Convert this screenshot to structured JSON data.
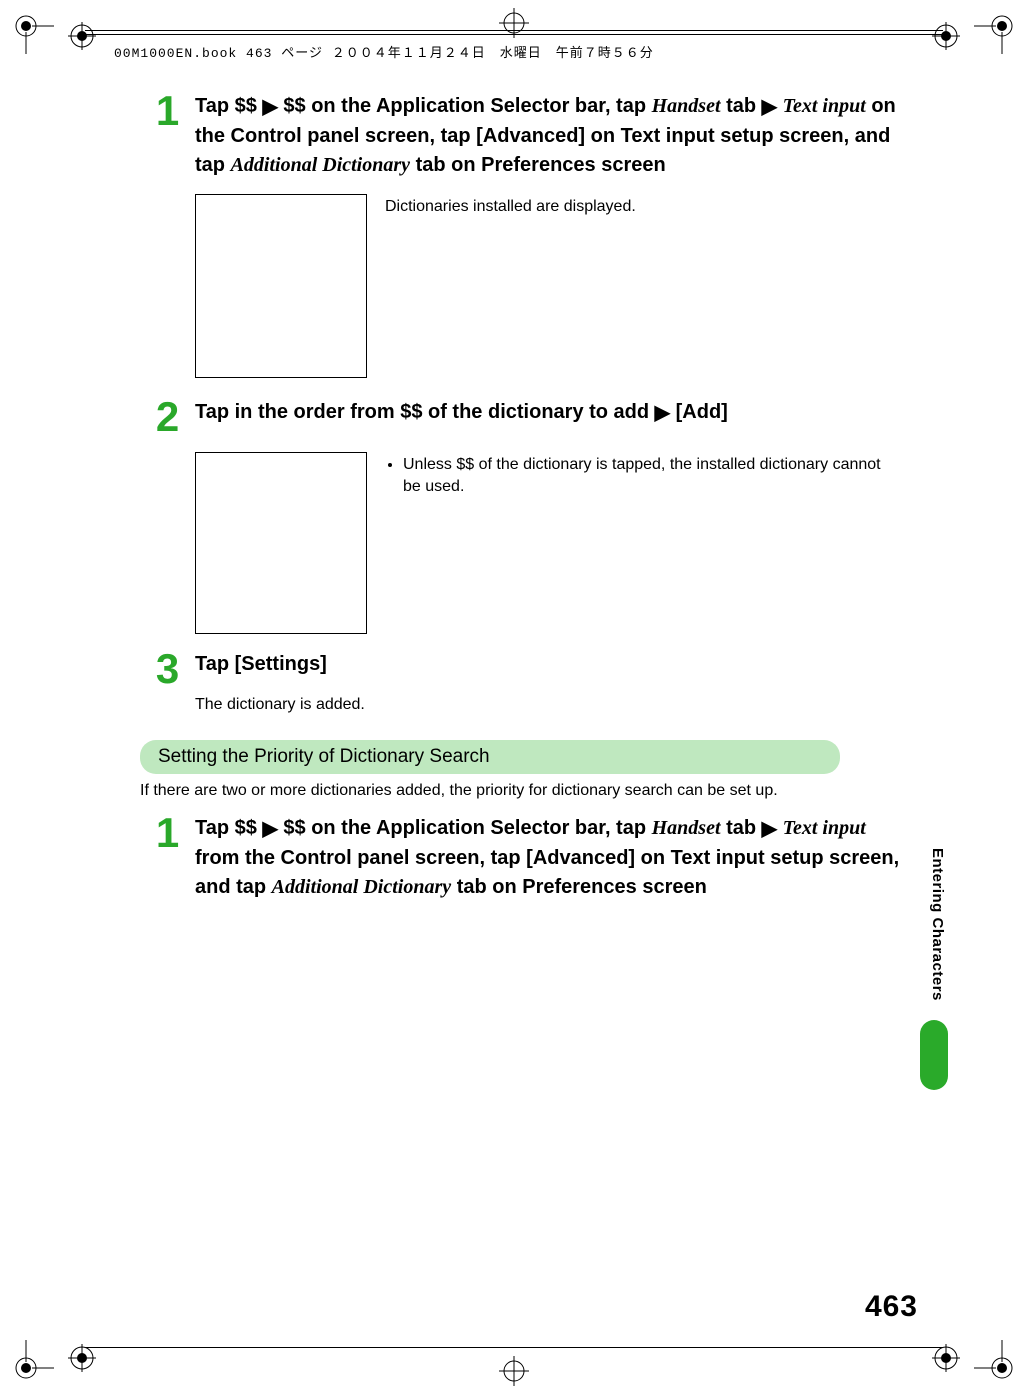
{
  "header": {
    "text": "00M1000EN.book  463 ページ  ２００４年１１月２４日　水曜日　午前７時５６分"
  },
  "steps_a": [
    {
      "num": "1",
      "heading_parts": [
        {
          "t": "Tap $$ ",
          "cls": ""
        },
        {
          "t": "▶",
          "cls": "arrow"
        },
        {
          "t": " $$ on the Application Selector bar, tap ",
          "cls": ""
        },
        {
          "t": "Handset",
          "cls": "italic"
        },
        {
          "t": " tab ",
          "cls": ""
        },
        {
          "t": "▶",
          "cls": "arrow"
        },
        {
          "t": " ",
          "cls": ""
        },
        {
          "t": "Text input",
          "cls": "italic"
        },
        {
          "t": " on the Control panel screen, tap [Advanced] on Text input setup screen, and tap ",
          "cls": ""
        },
        {
          "t": "Additional Dictionary",
          "cls": "italic"
        },
        {
          "t": " tab on Preferences screen",
          "cls": ""
        }
      ],
      "side_note": "Dictionaries installed are displayed.",
      "has_box": true
    },
    {
      "num": "2",
      "heading_parts": [
        {
          "t": "Tap in the order from $$ of the dictionary to add ",
          "cls": ""
        },
        {
          "t": "▶",
          "cls": "arrow"
        },
        {
          "t": " [Add]",
          "cls": ""
        }
      ],
      "side_bullet": "Unless $$ of the dictionary is tapped, the installed dictionary cannot be used.",
      "has_box": true
    },
    {
      "num": "3",
      "heading_parts": [
        {
          "t": "Tap [Settings]",
          "cls": ""
        }
      ],
      "sub_note": "The dictionary is added."
    }
  ],
  "section": {
    "title": "Setting the Priority of Dictionary Search",
    "desc": "If there are two or more dictionaries added, the priority for dictionary search can be set up."
  },
  "steps_b": [
    {
      "num": "1",
      "heading_parts": [
        {
          "t": "Tap $$ ",
          "cls": ""
        },
        {
          "t": "▶",
          "cls": "arrow"
        },
        {
          "t": " $$ on the Application Selector bar, tap ",
          "cls": ""
        },
        {
          "t": "Handset",
          "cls": "italic"
        },
        {
          "t": " tab ",
          "cls": ""
        },
        {
          "t": "▶",
          "cls": "arrow"
        },
        {
          "t": " ",
          "cls": ""
        },
        {
          "t": "Text input",
          "cls": "italic"
        },
        {
          "t": " from the Control panel screen, tap [Advanced] on Text input setup screen, and tap ",
          "cls": ""
        },
        {
          "t": "Additional Dictionary",
          "cls": "italic"
        },
        {
          "t": " tab on Preferences screen",
          "cls": ""
        }
      ]
    }
  ],
  "side_tab_label": "Entering Characters",
  "page_number": "463"
}
